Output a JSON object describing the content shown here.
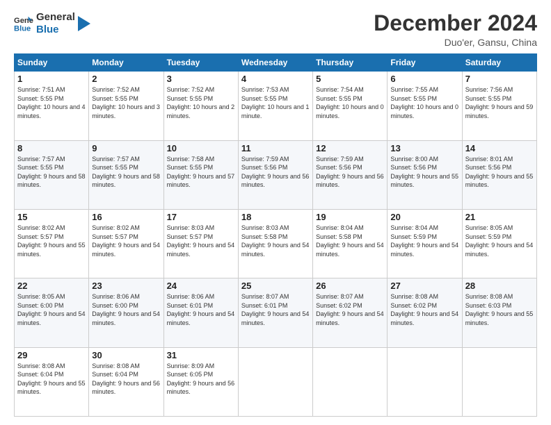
{
  "logo": {
    "line1": "General",
    "line2": "Blue"
  },
  "title": "December 2024",
  "location": "Duo'er, Gansu, China",
  "headers": [
    "Sunday",
    "Monday",
    "Tuesday",
    "Wednesday",
    "Thursday",
    "Friday",
    "Saturday"
  ],
  "weeks": [
    [
      {
        "day": "1",
        "sunrise": "7:51 AM",
        "sunset": "5:55 PM",
        "daylight": "10 hours and 4 minutes."
      },
      {
        "day": "2",
        "sunrise": "7:52 AM",
        "sunset": "5:55 PM",
        "daylight": "10 hours and 3 minutes."
      },
      {
        "day": "3",
        "sunrise": "7:52 AM",
        "sunset": "5:55 PM",
        "daylight": "10 hours and 2 minutes."
      },
      {
        "day": "4",
        "sunrise": "7:53 AM",
        "sunset": "5:55 PM",
        "daylight": "10 hours and 1 minute."
      },
      {
        "day": "5",
        "sunrise": "7:54 AM",
        "sunset": "5:55 PM",
        "daylight": "10 hours and 0 minutes."
      },
      {
        "day": "6",
        "sunrise": "7:55 AM",
        "sunset": "5:55 PM",
        "daylight": "10 hours and 0 minutes."
      },
      {
        "day": "7",
        "sunrise": "7:56 AM",
        "sunset": "5:55 PM",
        "daylight": "9 hours and 59 minutes."
      }
    ],
    [
      {
        "day": "8",
        "sunrise": "7:57 AM",
        "sunset": "5:55 PM",
        "daylight": "9 hours and 58 minutes."
      },
      {
        "day": "9",
        "sunrise": "7:57 AM",
        "sunset": "5:55 PM",
        "daylight": "9 hours and 58 minutes."
      },
      {
        "day": "10",
        "sunrise": "7:58 AM",
        "sunset": "5:55 PM",
        "daylight": "9 hours and 57 minutes."
      },
      {
        "day": "11",
        "sunrise": "7:59 AM",
        "sunset": "5:56 PM",
        "daylight": "9 hours and 56 minutes."
      },
      {
        "day": "12",
        "sunrise": "7:59 AM",
        "sunset": "5:56 PM",
        "daylight": "9 hours and 56 minutes."
      },
      {
        "day": "13",
        "sunrise": "8:00 AM",
        "sunset": "5:56 PM",
        "daylight": "9 hours and 55 minutes."
      },
      {
        "day": "14",
        "sunrise": "8:01 AM",
        "sunset": "5:56 PM",
        "daylight": "9 hours and 55 minutes."
      }
    ],
    [
      {
        "day": "15",
        "sunrise": "8:02 AM",
        "sunset": "5:57 PM",
        "daylight": "9 hours and 55 minutes."
      },
      {
        "day": "16",
        "sunrise": "8:02 AM",
        "sunset": "5:57 PM",
        "daylight": "9 hours and 54 minutes."
      },
      {
        "day": "17",
        "sunrise": "8:03 AM",
        "sunset": "5:57 PM",
        "daylight": "9 hours and 54 minutes."
      },
      {
        "day": "18",
        "sunrise": "8:03 AM",
        "sunset": "5:58 PM",
        "daylight": "9 hours and 54 minutes."
      },
      {
        "day": "19",
        "sunrise": "8:04 AM",
        "sunset": "5:58 PM",
        "daylight": "9 hours and 54 minutes."
      },
      {
        "day": "20",
        "sunrise": "8:04 AM",
        "sunset": "5:59 PM",
        "daylight": "9 hours and 54 minutes."
      },
      {
        "day": "21",
        "sunrise": "8:05 AM",
        "sunset": "5:59 PM",
        "daylight": "9 hours and 54 minutes."
      }
    ],
    [
      {
        "day": "22",
        "sunrise": "8:05 AM",
        "sunset": "6:00 PM",
        "daylight": "9 hours and 54 minutes."
      },
      {
        "day": "23",
        "sunrise": "8:06 AM",
        "sunset": "6:00 PM",
        "daylight": "9 hours and 54 minutes."
      },
      {
        "day": "24",
        "sunrise": "8:06 AM",
        "sunset": "6:01 PM",
        "daylight": "9 hours and 54 minutes."
      },
      {
        "day": "25",
        "sunrise": "8:07 AM",
        "sunset": "6:01 PM",
        "daylight": "9 hours and 54 minutes."
      },
      {
        "day": "26",
        "sunrise": "8:07 AM",
        "sunset": "6:02 PM",
        "daylight": "9 hours and 54 minutes."
      },
      {
        "day": "27",
        "sunrise": "8:08 AM",
        "sunset": "6:02 PM",
        "daylight": "9 hours and 54 minutes."
      },
      {
        "day": "28",
        "sunrise": "8:08 AM",
        "sunset": "6:03 PM",
        "daylight": "9 hours and 55 minutes."
      }
    ],
    [
      {
        "day": "29",
        "sunrise": "8:08 AM",
        "sunset": "6:04 PM",
        "daylight": "9 hours and 55 minutes."
      },
      {
        "day": "30",
        "sunrise": "8:08 AM",
        "sunset": "6:04 PM",
        "daylight": "9 hours and 56 minutes."
      },
      {
        "day": "31",
        "sunrise": "8:09 AM",
        "sunset": "6:05 PM",
        "daylight": "9 hours and 56 minutes."
      },
      null,
      null,
      null,
      null
    ]
  ],
  "labels": {
    "sunrise": "Sunrise:",
    "sunset": "Sunset:",
    "daylight": "Daylight:"
  }
}
